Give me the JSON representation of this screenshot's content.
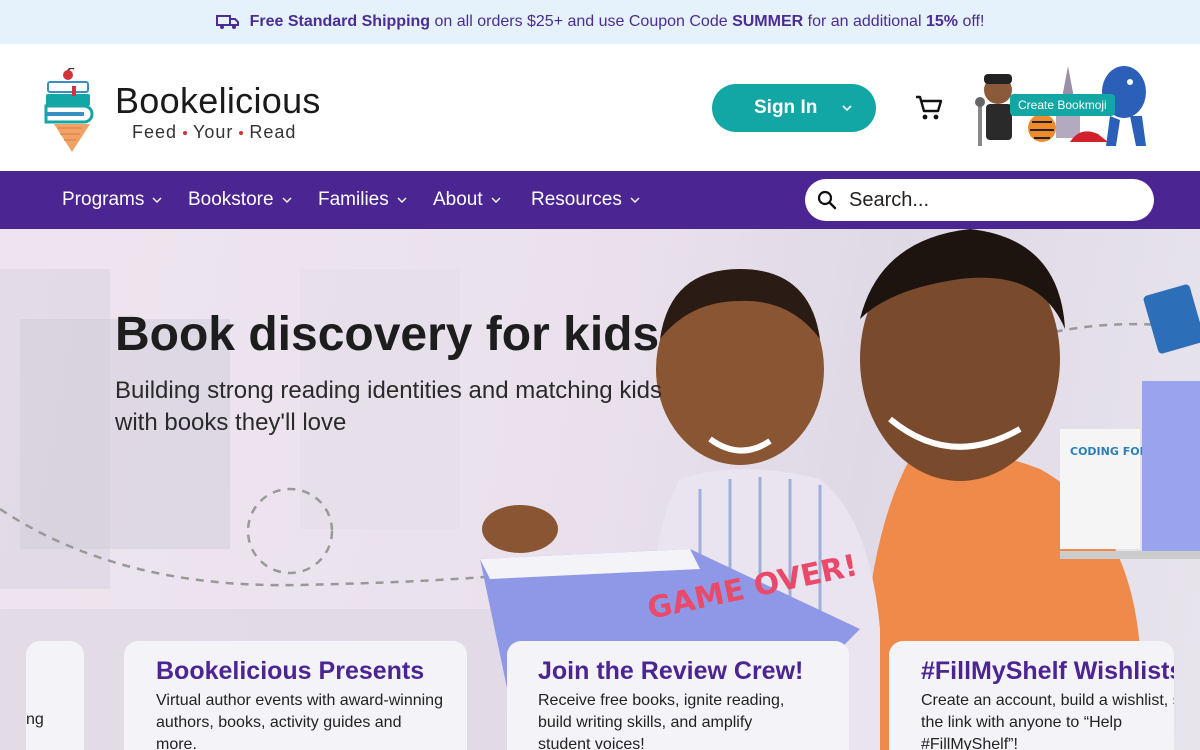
{
  "promo": {
    "bold_lead": "Free Standard Shipping",
    "text_1": "on all orders $25+ and use Coupon Code",
    "code": "SUMMER",
    "text_2": "for an additional",
    "percent": "15%",
    "text_3": "off!"
  },
  "header": {
    "brand": "Bookelicious",
    "tagline": [
      "Feed",
      "Your",
      "Read"
    ],
    "signin_label": "Sign In",
    "bookmoji_label": "Create Bookmoji"
  },
  "nav": {
    "items": [
      {
        "label": "Programs"
      },
      {
        "label": "Bookstore"
      },
      {
        "label": "Families"
      },
      {
        "label": "About"
      },
      {
        "label": "Resources"
      }
    ],
    "search_placeholder": "Search..."
  },
  "hero": {
    "title": "Book discovery for kids",
    "subtitle": "Building strong reading identities and matching kids with books they'll love",
    "book_titles": [
      "GAME OVER!",
      "CODING FOR KIDS"
    ]
  },
  "cards": [
    {
      "title": "Bookelicious Presents",
      "text": "Virtual author events with award-winning authors, books, activity guides and more."
    },
    {
      "title": "Join the Review Crew!",
      "text": "Receive free books, ignite reading, build writing skills, and amplify student voices!"
    },
    {
      "title": "#FillMyShelf Wishlists",
      "text": "Create an account, build a wishlist, share the link with anyone to “Help #FillMyShelf”!"
    }
  ],
  "partial_card_text": "ng",
  "colors": {
    "brand_purple": "#4b2591",
    "teal": "#12a7a4",
    "promo_bg": "#e5f1fb"
  }
}
